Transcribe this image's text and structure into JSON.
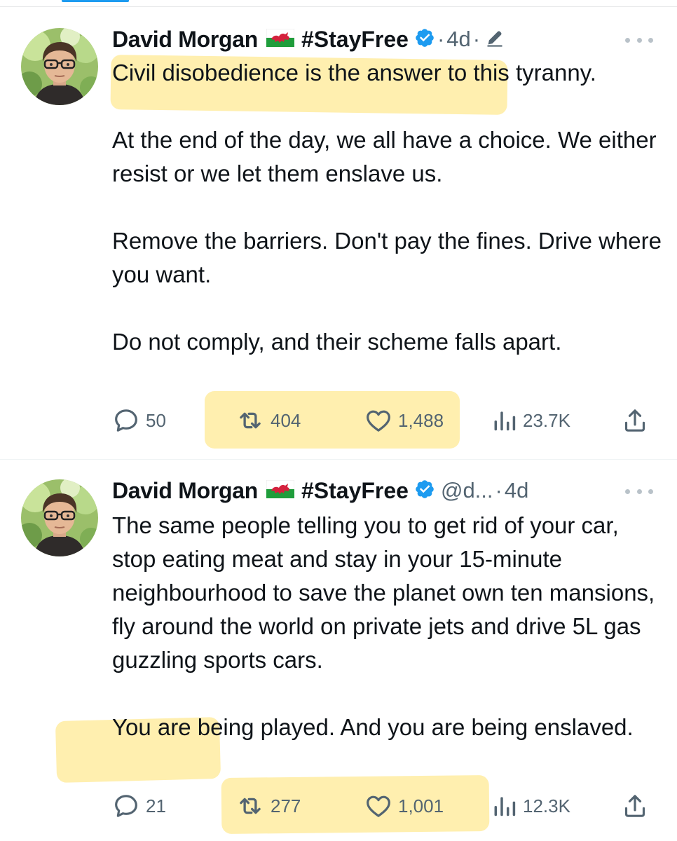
{
  "colors": {
    "accent": "#1d9bf0",
    "text_primary": "#0f1419",
    "text_secondary": "#536471",
    "highlight": "#ffe05f"
  },
  "tweets": [
    {
      "author": "David Morgan",
      "flag_icon": "wales-flag-icon",
      "tag": "#StayFree",
      "verified_icon": "verified-badge-icon",
      "handle": "",
      "sep1": "·",
      "time": "4d",
      "sep2": "·",
      "edited_icon": "pencil-icon",
      "paragraphs": [
        "Civil disobedience is the answer to this tyranny.",
        "At the end of the day, we all have a choice. We either resist or we let them enslave us.",
        "Remove the barriers. Don't pay the fines. Drive where you want.",
        "Do not comply, and their scheme falls apart."
      ],
      "replies": "50",
      "reposts": "404",
      "likes": "1,488",
      "views": "23.7K"
    },
    {
      "author": "David Morgan",
      "flag_icon": "wales-flag-icon",
      "tag": "#StayFree",
      "verified_icon": "verified-badge-icon",
      "handle": "@d...",
      "sep1": "·",
      "time": "4d",
      "paragraphs": [
        "The same people telling you to get rid of your car, stop eating meat and stay in your 15-minute neighbourhood to save the planet own ten mansions, fly around the world on private jets and drive 5L gas guzzling sports cars.",
        "You are being played. And you are being enslaved."
      ],
      "replies": "21",
      "reposts": "277",
      "likes": "1,001",
      "views": "12.3K"
    }
  ]
}
